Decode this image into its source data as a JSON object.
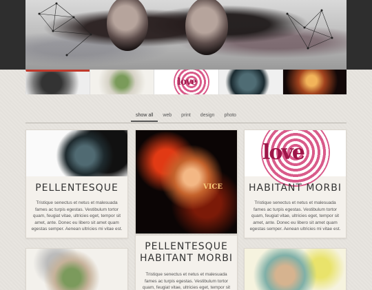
{
  "filters": {
    "items": [
      "show all",
      "web",
      "print",
      "design",
      "photo"
    ],
    "active": "show all"
  },
  "thumbnails": {
    "love_word": "love"
  },
  "cards": [
    {
      "title": "PELLENTESQUE",
      "body": "Tristique senectus et netus et malesuada fames ac turpis egestas. Vestibulum tortor quam, feugiat vitae, ultricies eget, tempor sit amet, ante. Donec eu libero sit amet quam egestas semper. Aenean ultricies mi vitae est."
    },
    {
      "image_text": "VICE",
      "title": "PELLENTESQUE HABITANT MORBI",
      "body": "Tristique senectus et netus et malesuada fames ac turpis egestas. Vestibulum tortor quam, feugiat vitae, ultricies eget, tempor sit amet,"
    },
    {
      "image_text": "love",
      "title": "HABITANT MORBI",
      "body": "Tristique senectus et netus et malesuada fames ac turpis egestas. Vestibulum tortor quam, feugiat vitae, ultricies eget, tempor sit amet, ante. Donec eu libero sit amet quam egestas semper. Aenean ultricies mi vitae est."
    }
  ],
  "colors": {
    "accent": "#c0392b",
    "background": "#e8e5e0",
    "header": "#2e2e2e"
  }
}
